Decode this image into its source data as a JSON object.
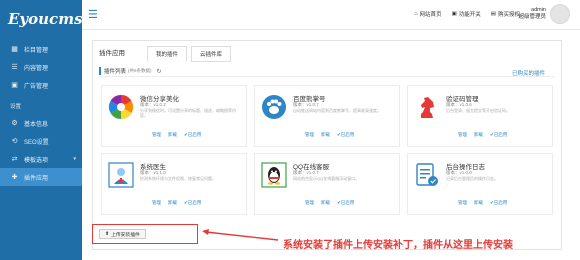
{
  "brand": {
    "logo_text": "Eyoucms"
  },
  "sidebar": {
    "items": [
      {
        "label": "栏目管理",
        "icon": "grid-icon"
      },
      {
        "label": "内容管理",
        "icon": "list-icon"
      },
      {
        "label": "广告管理",
        "icon": "image-icon"
      }
    ],
    "section_label": "设置",
    "settings_items": [
      {
        "label": "基本信息",
        "icon": "gear-icon"
      },
      {
        "label": "SEO设置",
        "icon": "seo-icon"
      },
      {
        "label": "模板选项",
        "icon": "template-icon"
      },
      {
        "label": "插件应用",
        "icon": "plugin-icon",
        "active": true
      }
    ]
  },
  "topbar": {
    "links": [
      {
        "label": "网站首页",
        "icon": "home-icon"
      },
      {
        "label": "功能开关",
        "icon": "toggle-icon"
      },
      {
        "label": "购买授权",
        "icon": "bookmark-icon"
      }
    ],
    "user": {
      "name": "admin",
      "role": "超级管理员"
    }
  },
  "panel": {
    "title": "插件应用",
    "tabs": [
      "我的插件",
      "云插件库"
    ],
    "list_title": "插件列表",
    "list_count": "(共6条数据)",
    "installed_link": "已购买的插件"
  },
  "cards": [
    {
      "name": "微信分享美化",
      "version": "版本：v1.0.2",
      "desc": "分享到微信时，可设置分享的标题、描述、缩略图等内容。",
      "actions": [
        "管理",
        "卸载"
      ],
      "status": "已启用",
      "icon": "aperture-icon"
    },
    {
      "name": "百度熊掌号",
      "version": "版本：v1.0.7",
      "desc": "自动推送网站内容到百度熊掌号，提高收录速度。",
      "actions": [
        "管理",
        "卸载"
      ],
      "status": "已启用",
      "icon": "paw-icon"
    },
    {
      "name": "验证码管理",
      "version": "版本：v1.0.6",
      "desc": "后台登录、留言提交等开启验证码。",
      "actions": [
        "管理",
        "卸载"
      ],
      "status": "已启用",
      "icon": "knight-icon"
    },
    {
      "name": "系统医生",
      "version": "版本：v1.1.0",
      "desc": "检测系统环境与文件权限，修复常见问题。",
      "actions": [
        "管理",
        "卸载"
      ],
      "status": "已启用",
      "icon": "doctor-icon"
    },
    {
      "name": "QQ在线客服",
      "version": "版本：v1.0.7",
      "desc": "网站前台显示QQ在线客服浮动窗口。",
      "actions": [
        "管理",
        "卸载"
      ],
      "status": "已启用",
      "icon": "qq-icon"
    },
    {
      "name": "后台操作日志",
      "version": "版本：v1.0.0",
      "desc": "记录后台管理员的操作日志。",
      "actions": [
        "管理",
        "卸载"
      ],
      "status": "已启用",
      "icon": "log-icon"
    }
  ],
  "upload": {
    "button_label": "上传安装插件"
  },
  "annotation": {
    "text": "系统安装了插件上传安装补丁，插件从这里上传安装"
  },
  "colors": {
    "sidebar": "#1f6ea7",
    "accent": "#2f86c6",
    "annotation": "#e53935"
  }
}
